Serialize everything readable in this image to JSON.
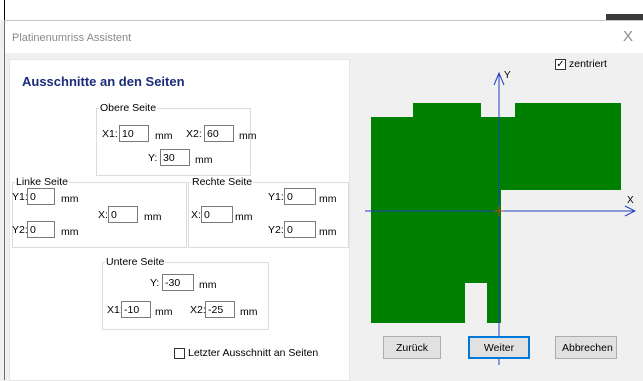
{
  "window": {
    "title": "Platinenumriss Assistent",
    "close_glyph": "X"
  },
  "heading": "Ausschnitte an den Seiten",
  "top_side": {
    "legend": "Obere Seite",
    "x1_label": "X1:",
    "x1_value": "10",
    "x1_unit": "mm",
    "x2_label": "X2:",
    "x2_value": "60",
    "x2_unit": "mm",
    "y_label": "Y:",
    "y_value": "30",
    "y_unit": "mm"
  },
  "left_side": {
    "legend": "Linke Seite",
    "y1_label": "Y1:",
    "y1_value": "0",
    "y1_unit": "mm",
    "y2_label": "Y2:",
    "y2_value": "0",
    "y2_unit": "mm",
    "x_label": "X:",
    "x_value": "0",
    "x_unit": "mm"
  },
  "right_side": {
    "legend": "Rechte Seite",
    "x_label": "X:",
    "x_value": "0",
    "x_unit": "mm",
    "y1_label": "Y1:",
    "y1_value": "0",
    "y1_unit": "mm",
    "y2_label": "Y2:",
    "y2_value": "0",
    "y2_unit": "mm"
  },
  "bottom_side": {
    "legend": "Untere Seite",
    "y_label": "Y:",
    "y_value": "-30",
    "y_unit": "mm",
    "x1_label": "X1:",
    "x1_value": "-10",
    "x1_unit": "mm",
    "x2_label": "X2:",
    "x2_value": "-25",
    "x2_unit": "mm"
  },
  "last_cutout": {
    "label": "Letzter Ausschnitt an Seiten",
    "checked": false
  },
  "centered": {
    "label": "zentriert",
    "checked": true
  },
  "preview": {
    "x_axis_label": "X",
    "y_axis_label": "Y",
    "board_color": "#008000",
    "axis_color": "#1f3fbf"
  },
  "buttons": {
    "back": "Zurück",
    "next": "Weiter",
    "cancel": "Abbrechen"
  }
}
